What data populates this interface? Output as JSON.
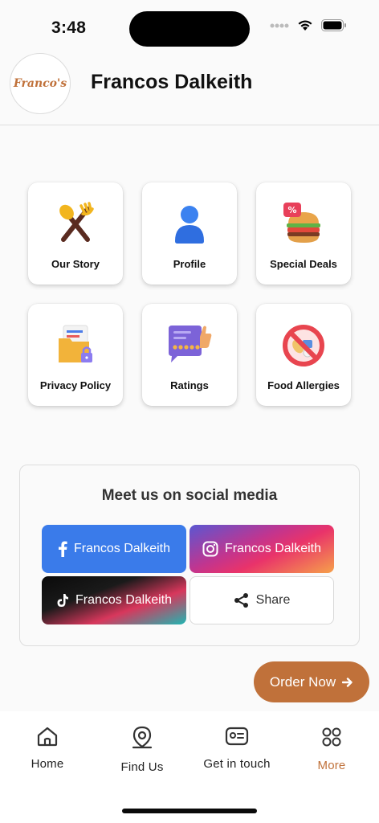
{
  "status_bar": {
    "time": "3:48"
  },
  "header": {
    "title": "Francos Dalkeith",
    "logo_text": "Franco's"
  },
  "tiles": [
    {
      "label": "Our Story",
      "icon": "cutlery-icon"
    },
    {
      "label": "Profile",
      "icon": "person-icon"
    },
    {
      "label": "Special Deals",
      "icon": "burger-deal-icon"
    },
    {
      "label": "Privacy Policy",
      "icon": "privacy-folder-icon"
    },
    {
      "label": "Ratings",
      "icon": "rating-icon"
    },
    {
      "label": "Food Allergies",
      "icon": "allergy-icon"
    }
  ],
  "social": {
    "title": "Meet us on social media",
    "facebook_label": "Francos Dalkeith",
    "instagram_label": "Francos Dalkeith",
    "tiktok_label": "Francos Dalkeith",
    "share_label": "Share"
  },
  "order_button": {
    "label": "Order Now"
  },
  "nav": {
    "items": [
      {
        "label": "Home",
        "icon": "home-icon"
      },
      {
        "label": "Find Us",
        "icon": "location-icon"
      },
      {
        "label": "Get in touch",
        "icon": "contact-card-icon"
      },
      {
        "label": "More",
        "icon": "grid-icon",
        "active": true
      }
    ]
  },
  "colors": {
    "accent": "#c0713a",
    "facebook": "#3a7bea",
    "background": "#fafafa"
  }
}
